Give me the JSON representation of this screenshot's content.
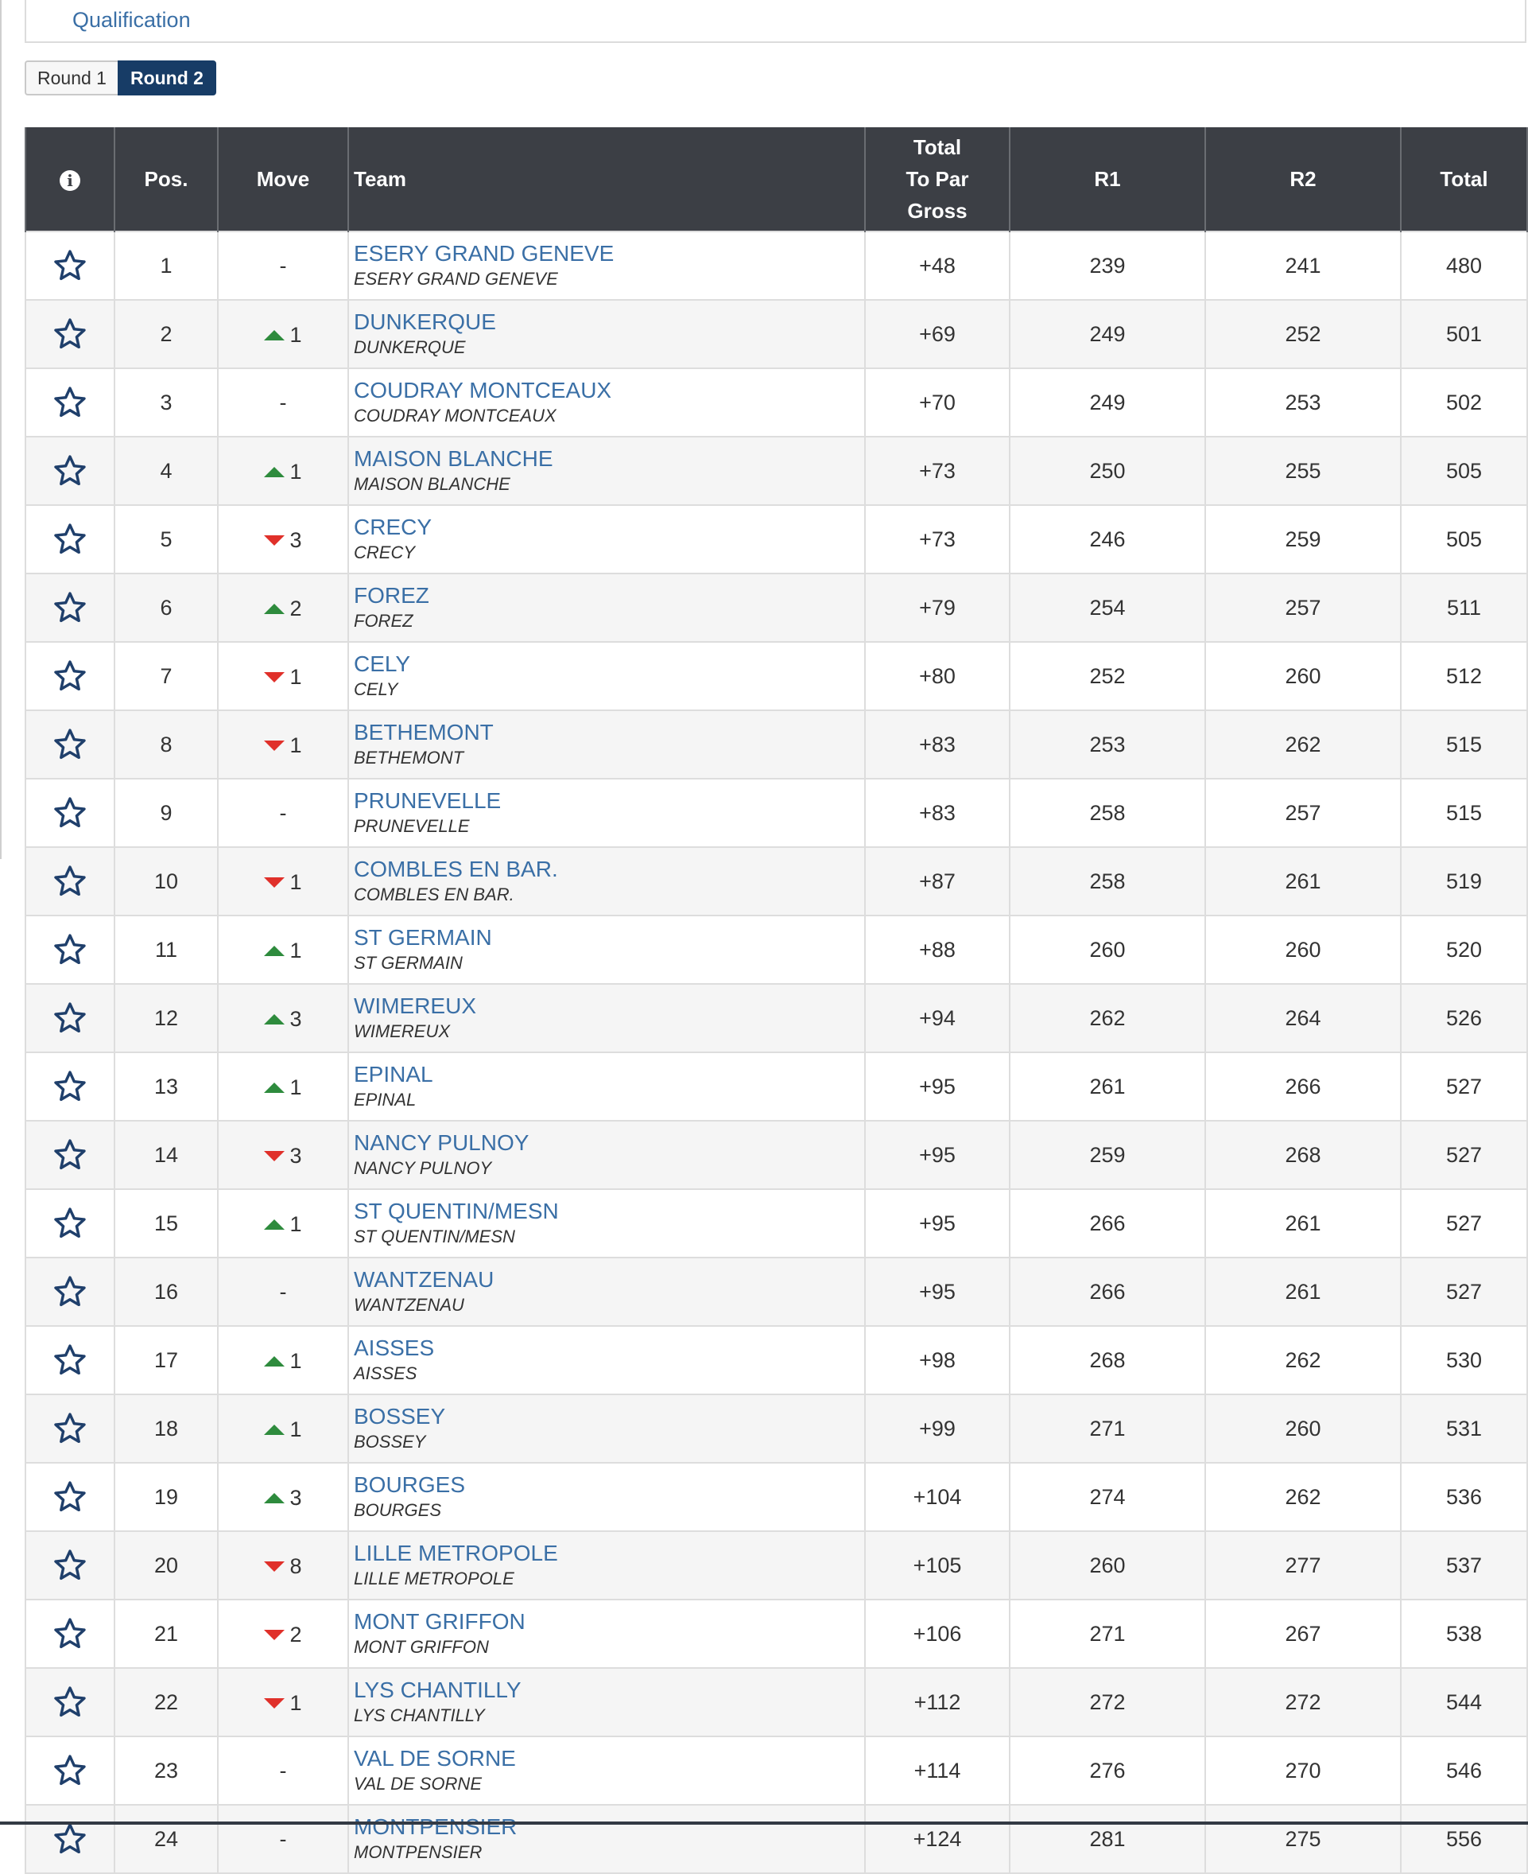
{
  "qualification_link": "Qualification",
  "round_tabs": [
    "Round 1",
    "Round 2"
  ],
  "active_round": "Round 2",
  "colors": {
    "header_bg": "#3c3f45",
    "link": "#3a6fa6",
    "up": "#2e8b3d",
    "down": "#e0302a",
    "active_tab": "#173c66"
  },
  "table": {
    "headers": {
      "info_icon": "info-icon",
      "pos": "Pos.",
      "move": "Move",
      "team": "Team",
      "to_par_1": "Total",
      "to_par_2": "To Par",
      "to_par_3": "Gross",
      "r1": "R1",
      "r2": "R2",
      "total": "Total"
    },
    "rows": [
      {
        "pos": "1",
        "dir": "none",
        "move": "-",
        "team": "ESERY GRAND GENEVE",
        "club": "ESERY GRAND GENEVE",
        "to_par": "+48",
        "r1": "239",
        "r2": "241",
        "total": "480"
      },
      {
        "pos": "2",
        "dir": "up",
        "move": "1",
        "team": "DUNKERQUE",
        "club": "DUNKERQUE",
        "to_par": "+69",
        "r1": "249",
        "r2": "252",
        "total": "501"
      },
      {
        "pos": "3",
        "dir": "none",
        "move": "-",
        "team": "COUDRAY MONTCEAUX",
        "club": "COUDRAY MONTCEAUX",
        "to_par": "+70",
        "r1": "249",
        "r2": "253",
        "total": "502"
      },
      {
        "pos": "4",
        "dir": "up",
        "move": "1",
        "team": "MAISON BLANCHE",
        "club": "MAISON BLANCHE",
        "to_par": "+73",
        "r1": "250",
        "r2": "255",
        "total": "505"
      },
      {
        "pos": "5",
        "dir": "down",
        "move": "3",
        "team": "CRECY",
        "club": "CRECY",
        "to_par": "+73",
        "r1": "246",
        "r2": "259",
        "total": "505"
      },
      {
        "pos": "6",
        "dir": "up",
        "move": "2",
        "team": "FOREZ",
        "club": "FOREZ",
        "to_par": "+79",
        "r1": "254",
        "r2": "257",
        "total": "511"
      },
      {
        "pos": "7",
        "dir": "down",
        "move": "1",
        "team": "CELY",
        "club": "CELY",
        "to_par": "+80",
        "r1": "252",
        "r2": "260",
        "total": "512"
      },
      {
        "pos": "8",
        "dir": "down",
        "move": "1",
        "team": "BETHEMONT",
        "club": "BETHEMONT",
        "to_par": "+83",
        "r1": "253",
        "r2": "262",
        "total": "515"
      },
      {
        "pos": "9",
        "dir": "none",
        "move": "-",
        "team": "PRUNEVELLE",
        "club": "PRUNEVELLE",
        "to_par": "+83",
        "r1": "258",
        "r2": "257",
        "total": "515"
      },
      {
        "pos": "10",
        "dir": "down",
        "move": "1",
        "team": "COMBLES EN BAR.",
        "club": "COMBLES EN BAR.",
        "to_par": "+87",
        "r1": "258",
        "r2": "261",
        "total": "519"
      },
      {
        "pos": "11",
        "dir": "up",
        "move": "1",
        "team": "ST GERMAIN",
        "club": "ST GERMAIN",
        "to_par": "+88",
        "r1": "260",
        "r2": "260",
        "total": "520"
      },
      {
        "pos": "12",
        "dir": "up",
        "move": "3",
        "team": "WIMEREUX",
        "club": "WIMEREUX",
        "to_par": "+94",
        "r1": "262",
        "r2": "264",
        "total": "526"
      },
      {
        "pos": "13",
        "dir": "up",
        "move": "1",
        "team": "EPINAL",
        "club": "EPINAL",
        "to_par": "+95",
        "r1": "261",
        "r2": "266",
        "total": "527"
      },
      {
        "pos": "14",
        "dir": "down",
        "move": "3",
        "team": "NANCY PULNOY",
        "club": "NANCY PULNOY",
        "to_par": "+95",
        "r1": "259",
        "r2": "268",
        "total": "527"
      },
      {
        "pos": "15",
        "dir": "up",
        "move": "1",
        "team": "ST QUENTIN/MESN",
        "club": "ST QUENTIN/MESN",
        "to_par": "+95",
        "r1": "266",
        "r2": "261",
        "total": "527"
      },
      {
        "pos": "16",
        "dir": "none",
        "move": "-",
        "team": "WANTZENAU",
        "club": "WANTZENAU",
        "to_par": "+95",
        "r1": "266",
        "r2": "261",
        "total": "527"
      },
      {
        "pos": "17",
        "dir": "up",
        "move": "1",
        "team": "AISSES",
        "club": "AISSES",
        "to_par": "+98",
        "r1": "268",
        "r2": "262",
        "total": "530"
      },
      {
        "pos": "18",
        "dir": "up",
        "move": "1",
        "team": "BOSSEY",
        "club": "BOSSEY",
        "to_par": "+99",
        "r1": "271",
        "r2": "260",
        "total": "531"
      },
      {
        "pos": "19",
        "dir": "up",
        "move": "3",
        "team": "BOURGES",
        "club": "BOURGES",
        "to_par": "+104",
        "r1": "274",
        "r2": "262",
        "total": "536"
      },
      {
        "pos": "20",
        "dir": "down",
        "move": "8",
        "team": "LILLE METROPOLE",
        "club": "LILLE METROPOLE",
        "to_par": "+105",
        "r1": "260",
        "r2": "277",
        "total": "537"
      },
      {
        "pos": "21",
        "dir": "down",
        "move": "2",
        "team": "MONT GRIFFON",
        "club": "MONT GRIFFON",
        "to_par": "+106",
        "r1": "271",
        "r2": "267",
        "total": "538"
      },
      {
        "pos": "22",
        "dir": "down",
        "move": "1",
        "team": "LYS CHANTILLY",
        "club": "LYS CHANTILLY",
        "to_par": "+112",
        "r1": "272",
        "r2": "272",
        "total": "544"
      },
      {
        "pos": "23",
        "dir": "none",
        "move": "-",
        "team": "VAL DE SORNE",
        "club": "VAL DE SORNE",
        "to_par": "+114",
        "r1": "276",
        "r2": "270",
        "total": "546"
      },
      {
        "pos": "24",
        "dir": "none",
        "move": "-",
        "team": "MONTPENSIER",
        "club": "MONTPENSIER",
        "to_par": "+124",
        "r1": "281",
        "r2": "275",
        "total": "556"
      }
    ]
  }
}
